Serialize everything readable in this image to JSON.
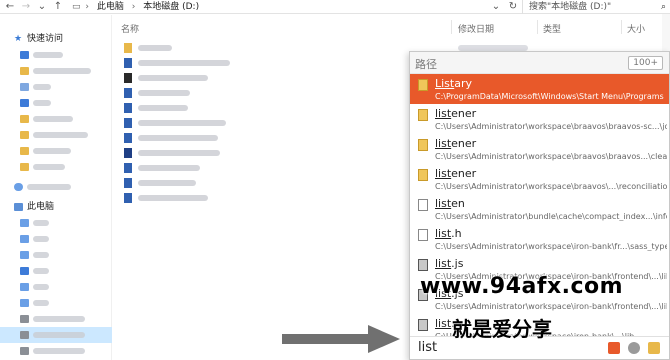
{
  "window": {
    "breadcrumb": [
      "此电脑",
      "本地磁盘 (D:)"
    ],
    "search_placeholder": "搜索\"本地磁盘 (D:)\""
  },
  "icons": {
    "back": "arrow-left-icon",
    "forward": "arrow-right-icon",
    "recent": "chevron-down-icon",
    "up": "arrow-up-icon",
    "refresh": "refresh-icon",
    "search": "search-icon"
  },
  "sidebar": {
    "quick_access_label": "快速访问",
    "this_pc_label": "此电脑"
  },
  "columns": {
    "name": "名称",
    "date": "修改日期",
    "type": "类型",
    "size": "大小"
  },
  "listary": {
    "title": "路径",
    "count": "100+",
    "query": "list",
    "accent": "#e8592a",
    "results": [
      {
        "prefix": "List",
        "rest": "ary",
        "path": "C:\\ProgramData\\Microsoft\\Windows\\Start Menu\\Programs",
        "icon": "folder-icon",
        "selected": true
      },
      {
        "prefix": "list",
        "rest": "ener",
        "path": "C:\\Users\\Administrator\\workspace\\braavos\\braavos-sc...\\job",
        "icon": "folder-icon",
        "selected": false
      },
      {
        "prefix": "list",
        "rest": "ener",
        "path": "C:\\Users\\Administrator\\workspace\\braavos\\braavos...\\clearing",
        "icon": "folder-icon",
        "selected": false
      },
      {
        "prefix": "list",
        "rest": "ener",
        "path": "C:\\Users\\Administrator\\workspace\\braavos\\...\\reconciliation",
        "icon": "folder-icon",
        "selected": false
      },
      {
        "prefix": "list",
        "rest": "en",
        "path": "C:\\Users\\Administrator\\bundle\\cache\\compact_index...\\info",
        "icon": "file-icon",
        "selected": false
      },
      {
        "prefix": "list",
        "rest": ".h",
        "path": "C:\\Users\\Administrator\\workspace\\iron-bank\\fr...\\sass_types",
        "icon": "file-icon",
        "selected": false
      },
      {
        "prefix": "list",
        "rest": ".js",
        "path": "C:\\Users\\Administrator\\workspace\\iron-bank\\frontend\\...\\lib",
        "icon": "js-file-icon",
        "selected": false
      },
      {
        "prefix": "list",
        "rest": ".js",
        "path": "C:\\Users\\Administrator\\workspace\\iron-bank\\frontend\\...\\lib",
        "icon": "js-file-icon",
        "selected": false
      },
      {
        "prefix": "list",
        "rest": ".js",
        "path": "C:\\Users\\Administrator\\workspace\\iron-bank\\...\\lib",
        "icon": "js-file-icon",
        "selected": false
      }
    ]
  },
  "watermark": {
    "url": "www.94afx.com",
    "slogan": "就是爱分享"
  }
}
